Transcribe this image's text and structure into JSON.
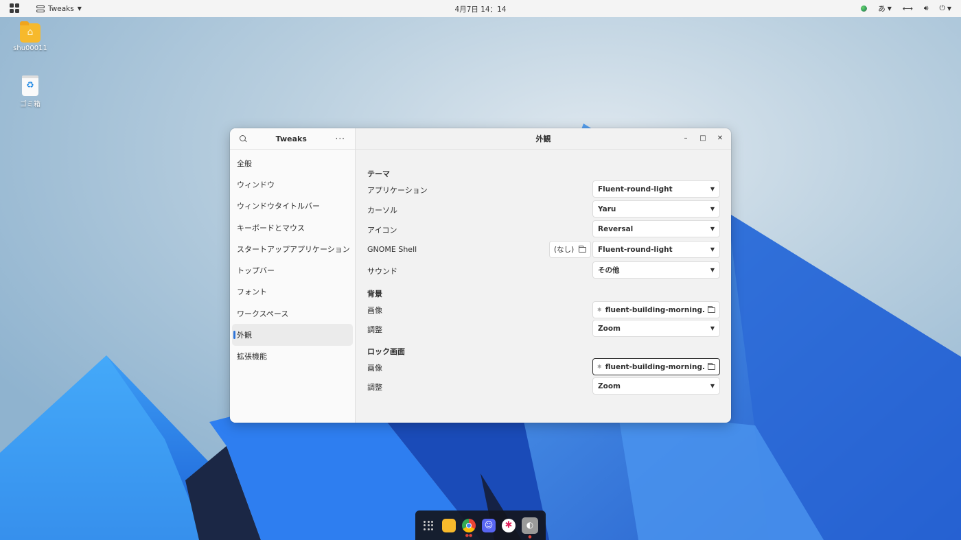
{
  "topbar": {
    "app_name": "Tweaks",
    "clock": "4月7日  14：14",
    "input_method": "あ"
  },
  "desktop": {
    "icons": [
      {
        "label": "shu00011"
      },
      {
        "label": "ゴミ箱"
      }
    ]
  },
  "window": {
    "sidebar_title": "Tweaks",
    "main_title": "外観",
    "sidebar_items": [
      {
        "label": "全般"
      },
      {
        "label": "ウィンドウ"
      },
      {
        "label": "ウィンドウタイトルバー"
      },
      {
        "label": "キーボードとマウス"
      },
      {
        "label": "スタートアップアプリケーション"
      },
      {
        "label": "トップバー"
      },
      {
        "label": "フォント"
      },
      {
        "label": "ワークスペース"
      },
      {
        "label": "外観"
      },
      {
        "label": "拡張機能"
      }
    ],
    "active_sidebar_item": "外観",
    "theme_section": {
      "title": "テーマ",
      "application_label": "アプリケーション",
      "application_value": "Fluent-round-light",
      "cursor_label": "カーソル",
      "cursor_value": "Yaru",
      "icon_label": "アイコン",
      "icon_value": "Reversal",
      "shell_label": "GNOME Shell",
      "shell_none_button": "(なし)",
      "shell_value": "Fluent-round-light",
      "sound_label": "サウンド",
      "sound_value": "その他"
    },
    "background_section": {
      "title": "背景",
      "image_label": "画像",
      "image_file": "fluent-building-morning.jpg",
      "adjust_label": "調整",
      "adjust_value": "Zoom"
    },
    "lock_section": {
      "title": "ロック画面",
      "image_label": "画像",
      "image_file": "fluent-building-morning.jpg",
      "adjust_label": "調整",
      "adjust_value": "Zoom"
    }
  },
  "colors": {
    "accent": "#2f74d8",
    "sky": "#a9c6dc",
    "mountain_blue": "#2f6fd8"
  }
}
